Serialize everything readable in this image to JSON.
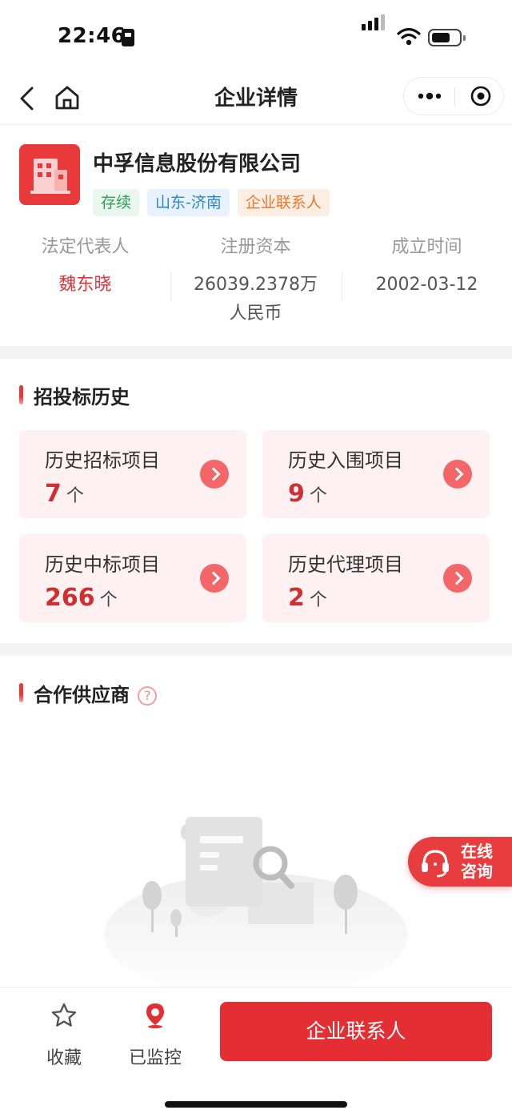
{
  "status_bar": {
    "time": "22:46"
  },
  "nav": {
    "title": "企业详情"
  },
  "company": {
    "name": "中孚信息股份有限公司",
    "tags": [
      {
        "label": "存续",
        "color": "#2f9e56"
      },
      {
        "label": "山东-济南",
        "color": "#2e86c9"
      },
      {
        "label": "企业联系人",
        "color": "#e37a2e"
      }
    ],
    "info": [
      {
        "label": "法定代表人",
        "value": "魏东晓",
        "value2": ""
      },
      {
        "label": "注册资本",
        "value": "26039.2378万",
        "value2": "人民币"
      },
      {
        "label": "成立时间",
        "value": "2002-03-12",
        "value2": ""
      }
    ]
  },
  "bidding_history": {
    "title": "招投标历史",
    "unit": "个",
    "cards": [
      {
        "label": "历史招标项目",
        "value": "7"
      },
      {
        "label": "历史入围项目",
        "value": "9"
      },
      {
        "label": "历史中标项目",
        "value": "266"
      },
      {
        "label": "历史代理项目",
        "value": "2"
      }
    ]
  },
  "suppliers": {
    "title": "合作供应商",
    "help": "?"
  },
  "consult": {
    "line1": "在线",
    "line2": "咨询"
  },
  "bottom_bar": {
    "favorite_label": "收藏",
    "monitor_label": "已监控",
    "contact_label": "企业联系人"
  },
  "colors": {
    "brand_red": "#e32f33",
    "card_bg": "#fff1f1"
  }
}
